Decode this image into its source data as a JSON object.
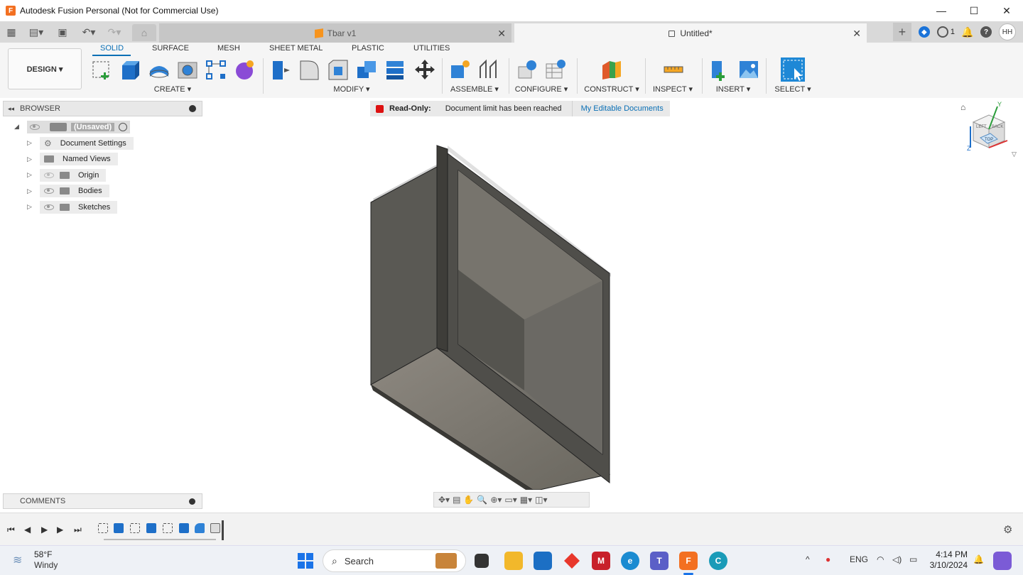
{
  "window": {
    "title": "Autodesk Fusion Personal (Not for Commercial Use)",
    "logo_letter": "F",
    "minimize": "—",
    "maximize": "☐",
    "close": "✕"
  },
  "tabs": {
    "inactive_tab": "Tbar v1",
    "active_tab": "Untitled*",
    "close": "✕",
    "plus": "+",
    "jobs_count": "1",
    "avatar": "HH"
  },
  "toolbar": {
    "design_button": "DESIGN ▾",
    "workspace_tabs": [
      "SOLID",
      "SURFACE",
      "MESH",
      "SHEET METAL",
      "PLASTIC",
      "UTILITIES"
    ],
    "groups": [
      "CREATE ▾",
      "MODIFY ▾",
      "ASSEMBLE ▾",
      "CONFIGURE ▾",
      "CONSTRUCT ▾",
      "INSPECT ▾",
      "INSERT ▾",
      "SELECT ▾"
    ]
  },
  "browser": {
    "header": "BROWSER",
    "root": "(Unsaved)",
    "items": [
      "Document Settings",
      "Named Views",
      "Origin",
      "Bodies",
      "Sketches"
    ]
  },
  "banner": {
    "label": "Read-Only:",
    "message": "Document limit has been reached",
    "link": "My Editable Documents"
  },
  "viewcube": {
    "top_face": "TOP",
    "left_face": "LEFT",
    "back_face": "BACK",
    "axis_y": "Y",
    "axis_z": "Z"
  },
  "comments": {
    "label": "COMMENTS"
  },
  "taskbar": {
    "weather_temp": "58°F",
    "weather_cond": "Windy",
    "search_placeholder": "Search",
    "language": "ENG",
    "time": "4:14 PM",
    "date": "3/10/2024"
  },
  "colors": {
    "accent": "#0a6fb5",
    "fusion_orange": "#f37021",
    "toolbar_bg": "#f5f5f5",
    "model_dark": "#5b5a55"
  }
}
